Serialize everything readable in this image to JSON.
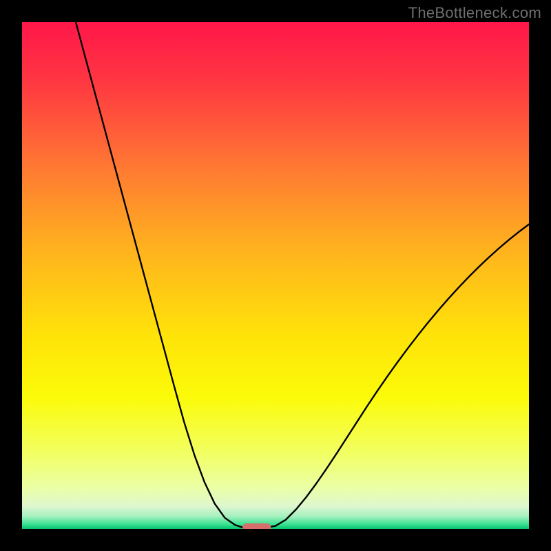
{
  "watermark": "TheBottleneck.com",
  "chart_data": {
    "type": "line",
    "title": "",
    "xlabel": "",
    "ylabel": "",
    "xlim": [
      0,
      100
    ],
    "ylim": [
      0,
      100
    ],
    "grid": false,
    "legend": false,
    "background": {
      "type": "vertical-gradient",
      "stops": [
        {
          "offset": 0.0,
          "color": "#ff1749"
        },
        {
          "offset": 0.11,
          "color": "#ff3442"
        },
        {
          "offset": 0.28,
          "color": "#ff7633"
        },
        {
          "offset": 0.45,
          "color": "#ffb31e"
        },
        {
          "offset": 0.62,
          "color": "#ffe309"
        },
        {
          "offset": 0.74,
          "color": "#fbfb09"
        },
        {
          "offset": 0.85,
          "color": "#f2ff62"
        },
        {
          "offset": 0.92,
          "color": "#eaffa7"
        },
        {
          "offset": 0.955,
          "color": "#def7cf"
        },
        {
          "offset": 0.975,
          "color": "#a6f0bf"
        },
        {
          "offset": 0.99,
          "color": "#3fe493"
        },
        {
          "offset": 1.0,
          "color": "#05c271"
        }
      ]
    },
    "series": [
      {
        "name": "left-branch",
        "x": [
          10.6,
          12,
          14,
          16,
          18,
          20,
          22,
          24,
          26,
          28,
          30,
          32,
          34,
          36,
          38,
          40,
          42,
          43.5,
          44.4
        ],
        "y": [
          100,
          94.8,
          87.4,
          80.0,
          72.6,
          65.2,
          57.8,
          50.4,
          43.0,
          35.6,
          28.2,
          21.0,
          14.6,
          9.2,
          5.0,
          2.2,
          0.8,
          0.3,
          0.3
        ]
      },
      {
        "name": "right-branch",
        "x": [
          48.3,
          50,
          52,
          54,
          56,
          58,
          60,
          62,
          64,
          66,
          68,
          70,
          72,
          74,
          76,
          78,
          80,
          82,
          84,
          86,
          88,
          90,
          92,
          94,
          96,
          98,
          100
        ],
        "y": [
          0.3,
          0.6,
          1.8,
          3.8,
          6.2,
          8.9,
          11.8,
          14.8,
          17.9,
          21.0,
          24.1,
          27.1,
          30.0,
          32.8,
          35.5,
          38.1,
          40.6,
          43.0,
          45.3,
          47.5,
          49.6,
          51.6,
          53.5,
          55.3,
          57.0,
          58.6,
          60.1
        ]
      }
    ],
    "marker": {
      "name": "bottom-highlight",
      "shape": "rounded-rect",
      "x_center": 46.3,
      "width": 5.6,
      "y_center": 0.3,
      "height": 1.6,
      "color": "#d66e6a"
    }
  }
}
